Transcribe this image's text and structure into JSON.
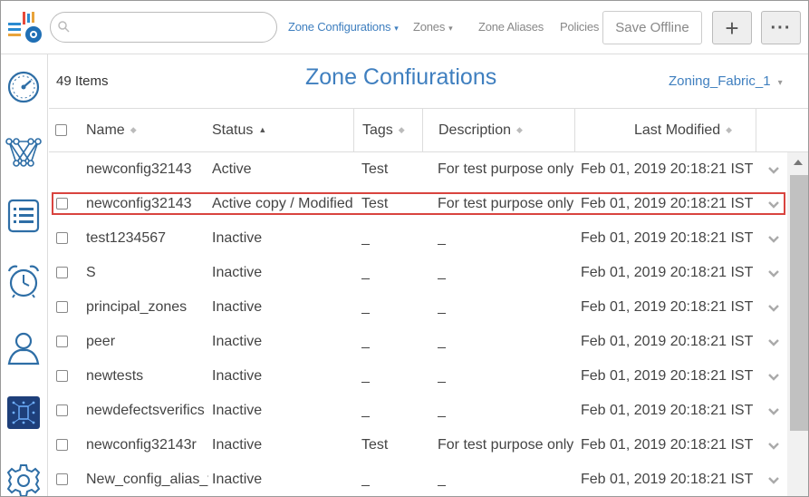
{
  "nav": {
    "search_placeholder": "",
    "items": [
      {
        "label": "Zone Configurations",
        "caret": "▾",
        "active": true
      },
      {
        "label": "Zones",
        "caret": "▾",
        "active": false
      },
      {
        "label": "Zone Aliases",
        "caret": "",
        "active": false
      },
      {
        "label": "Policies",
        "caret": "",
        "active": false
      }
    ],
    "save_offline_label": "Save Offline",
    "plus_label": "+",
    "more_label": "···"
  },
  "sidebar": {
    "icons": [
      "dashboard-gauge-icon",
      "network-topology-icon",
      "list-icon",
      "alarm-clock-icon",
      "user-icon",
      "fabric-chip-icon",
      "settings-gear-icon"
    ]
  },
  "header": {
    "item_count": "49 Items",
    "title": "Zone Confiurations",
    "fabric": "Zoning_Fabric_1",
    "fabric_caret": "▾"
  },
  "table": {
    "columns": [
      {
        "label": "Name",
        "sort": "◆"
      },
      {
        "label": "Status",
        "sort": "▲"
      },
      {
        "label": "Tags",
        "sort": "◆"
      },
      {
        "label": "Description",
        "sort": "◆"
      },
      {
        "label": "Last Modified",
        "sort": "◆"
      }
    ],
    "rows": [
      {
        "name": "newconfig32143",
        "status": "Active",
        "tags": "Test",
        "description": "For test purpose only.",
        "modified": "Feb 01, 2019 20:18:21 IST",
        "checkbox": false
      },
      {
        "name": "newconfig32143",
        "status": "Active copy / Modified",
        "tags": "Test",
        "description": "For test purpose only.",
        "modified": "Feb 01, 2019 20:18:21 IST",
        "checkbox": true
      },
      {
        "name": "test1234567",
        "status": "Inactive",
        "tags": "_",
        "description": "_",
        "modified": "Feb 01, 2019 20:18:21 IST",
        "checkbox": true
      },
      {
        "name": "S",
        "status": "Inactive",
        "tags": "_",
        "description": "_",
        "modified": "Feb 01, 2019 20:18:21 IST",
        "checkbox": true
      },
      {
        "name": "principal_zones",
        "status": "Inactive",
        "tags": "_",
        "description": "_",
        "modified": "Feb 01, 2019 20:18:21 IST",
        "checkbox": true
      },
      {
        "name": "peer",
        "status": "Inactive",
        "tags": "_",
        "description": "_",
        "modified": "Feb 01, 2019 20:18:21 IST",
        "checkbox": true
      },
      {
        "name": "newtests",
        "status": "Inactive",
        "tags": "_",
        "description": "_",
        "modified": "Feb 01, 2019 20:18:21 IST",
        "checkbox": true
      },
      {
        "name": "newdefectsverifics",
        "status": "Inactive",
        "tags": "_",
        "description": "_",
        "modified": "Feb 01, 2019 20:18:21 IST",
        "checkbox": true
      },
      {
        "name": "newconfig32143r",
        "status": "Inactive",
        "tags": "Test",
        "description": "For test purpose only.",
        "modified": "Feb 01, 2019 20:18:21 IST",
        "checkbox": true
      },
      {
        "name": "New_config_alias_v",
        "status": "Inactive",
        "tags": "_",
        "description": "_",
        "modified": "Feb 01, 2019 20:18:21 IST",
        "checkbox": true
      }
    ],
    "highlighted_row": 1
  },
  "colors": {
    "accent": "#3f7fbf",
    "highlight": "#d9443f"
  }
}
